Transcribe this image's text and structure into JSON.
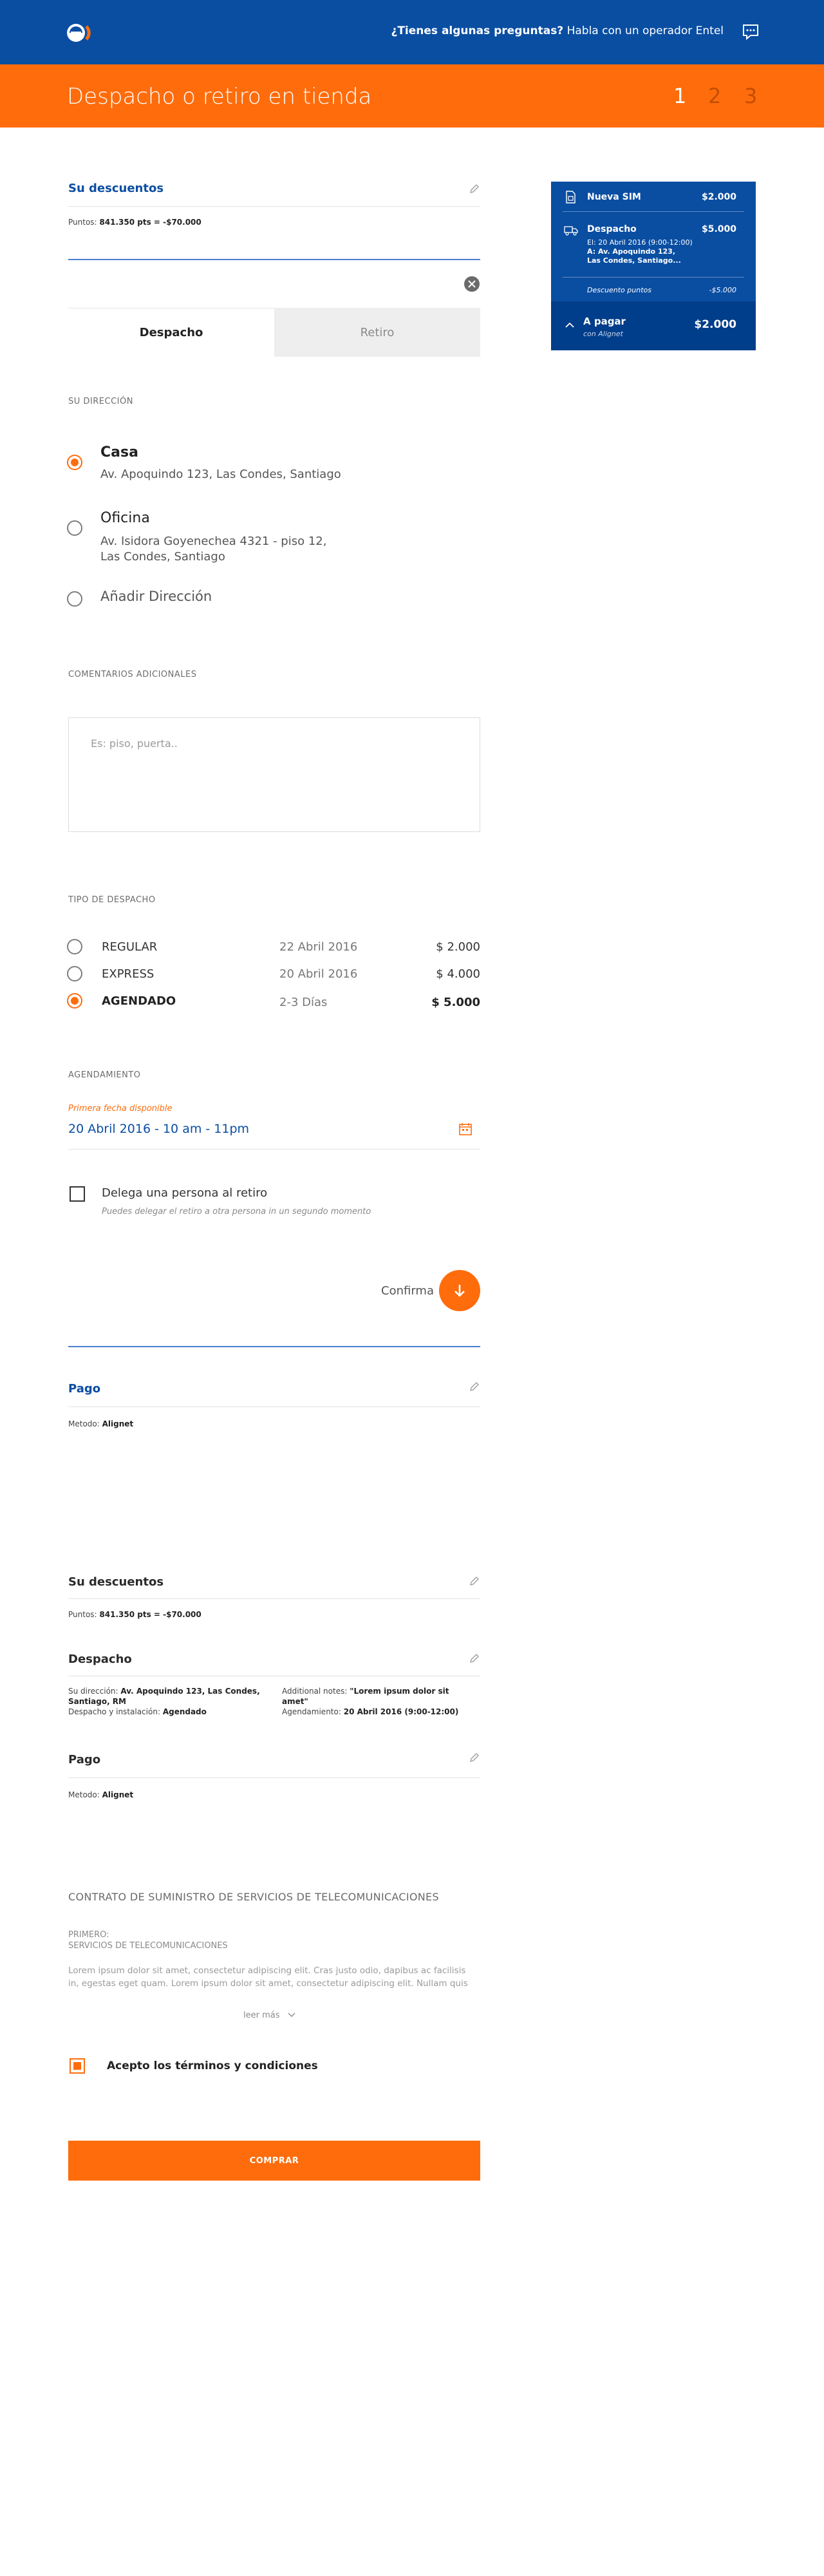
{
  "header": {
    "help_question": "¿Tienes algunas preguntas?",
    "help_text": "Habla con un operador Entel",
    "icons": {
      "logo": "entel-logo",
      "chat": "chat-bubble-icon"
    },
    "colors": {
      "brand_blue": "#0a4ea2",
      "brand_orange": "#ff6c0c"
    }
  },
  "steps": {
    "title": "Despacho o retiro en tienda",
    "items": [
      "1",
      "2",
      "3"
    ],
    "active": "1"
  },
  "discounts_top": {
    "title": "Su descuentos",
    "points_label": "Puntos:",
    "points_value": "841.350 pts = -$70.000"
  },
  "tabs": {
    "delivery": "Despacho",
    "pickup": "Retiro",
    "selected": "Despacho"
  },
  "address": {
    "section_label": "SU DIRECCIÓN",
    "items": [
      {
        "name": "Casa",
        "line1": "Av. Apoquindo 123, Las Condes, Santiago",
        "line2": "",
        "selected": true
      },
      {
        "name": "Oficina",
        "line1": "Av. Isidora Goyenechea 4321 - piso 12,",
        "line2": "Las Condes, Santiago",
        "selected": false
      }
    ],
    "add_label": "Añadir Dirección"
  },
  "comments": {
    "section_label": "COMENTARIOS ADICIONALES",
    "placeholder": "Es: piso, puerta.."
  },
  "shipping": {
    "section_label": "TIPO DE DESPACHO",
    "options": [
      {
        "name": "REGULAR",
        "date": "22 Abril 2016",
        "price": "$ 2.000",
        "selected": false
      },
      {
        "name": "EXPRESS",
        "date": "20 Abril 2016",
        "price": "$ 4.000",
        "selected": false
      },
      {
        "name": "AGENDADO",
        "date": "2-3 Días",
        "price": "$ 5.000",
        "selected": true
      }
    ]
  },
  "schedule": {
    "section_label": "AGENDAMIENTO",
    "field_label": "Primera fecha disponible",
    "field_value": "20 Abril 2016 - 10 am - 11pm",
    "icons": {
      "calendar": "calendar-icon"
    }
  },
  "delegate": {
    "label": "Delega una persona al retiro",
    "hint": "Puedes delegar el retiro a otra persona in un segundo momento",
    "checked": false
  },
  "confirm": {
    "label": "Confirma",
    "icon": "arrow-down-icon"
  },
  "payment_top": {
    "title": "Pago",
    "method_label": "Metodo:",
    "method_value": "Alignet"
  },
  "review": {
    "discounts": {
      "title": "Su descuentos",
      "points_label": "Puntos:",
      "points_value": "841.350 pts = -$70.000"
    },
    "delivery": {
      "title": "Despacho",
      "address_label": "Su dirección:",
      "address_value_1": "Av. Apoquindo 123, Las Condes,",
      "address_value_2": "Santiago, RM",
      "install_label": "Despacho y instalación:",
      "install_value": "Agendado",
      "notes_label": "Additional notes:",
      "notes_value_1": "\"Lorem ipsum dolor sit",
      "notes_value_2": "amet\"",
      "schedule_label": "Agendamiento:",
      "schedule_value": "20 Abril 2016 (9:00-12:00)"
    },
    "payment": {
      "title": "Pago",
      "method_label": "Metodo:",
      "method_value": "Alignet"
    }
  },
  "contract": {
    "title": "CONTRATO DE SUMINISTRO DE SERVICIOS DE TELECOMUNICACIONES",
    "sub1": "PRIMERO:",
    "sub2": "SERVICIOS DE TELECOMUNICACIONES",
    "body1": "Lorem ipsum dolor sit amet, consectetur adipiscing elit. Cras justo odio, dapibus ac facilisis",
    "body2": "in, egestas eget quam. Lorem ipsum dolor sit amet, consectetur adipiscing elit. Nullam quis",
    "read_more": "leer más"
  },
  "terms": {
    "label": "Acepto los términos y condiciones",
    "checked": true
  },
  "buy_button": "COMPRAR",
  "summary": {
    "sim_label": "Nueva SIM",
    "sim_price": "$2.000",
    "delivery_label": "Despacho",
    "delivery_price": "$5.000",
    "delivery_line1": "El: 20 Abril 2016 (9:00-12:00)",
    "delivery_line2": "A: Av. Apoquindo 123,",
    "delivery_line3": "Las Condes, Santiago...",
    "discount_label": "Descuento puntos",
    "discount_value": "-$5.000",
    "pay_label": "A pagar",
    "pay_sub": "con Alignet",
    "pay_total": "$2.000",
    "icons": {
      "sim": "sim-card-icon",
      "truck": "truck-icon",
      "toggle": "chevron-up-icon"
    }
  }
}
